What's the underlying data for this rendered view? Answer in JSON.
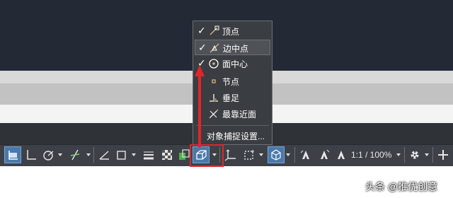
{
  "snap_menu": {
    "items": [
      {
        "label": "顶点",
        "checked": true,
        "icon": "endpoint-snap-icon"
      },
      {
        "label": "边中点",
        "checked": true,
        "icon": "midpoint-snap-icon",
        "highlighted": true
      },
      {
        "label": "面中心",
        "checked": true,
        "icon": "face-center-snap-icon"
      },
      {
        "label": "节点",
        "checked": false,
        "icon": "node-snap-icon"
      },
      {
        "label": "垂足",
        "checked": false,
        "icon": "perpendicular-snap-icon"
      },
      {
        "label": "最靠近面",
        "checked": false,
        "icon": "nearest-face-snap-icon"
      }
    ],
    "check_mark": "✓",
    "settings_label": "对象捕捉设置..."
  },
  "statusbar": {
    "annotation_scale": "1:1 / 100%",
    "icons": [
      "dynamic-ucs-icon",
      "ortho-icon",
      "polar-tracking-icon",
      "isodraft-icon",
      "object-snap-tracking-icon",
      "object-snap-icon",
      "lineweight-icon",
      "transparency-icon",
      "selection-cycling-icon",
      "3d-object-snap-icon",
      "gizmo-icon",
      "selection-filter-icon",
      "ucs-3d-icon",
      "annotation-visibility-icon",
      "auto-scale-icon",
      "annotation-scale-icon",
      "workspace-gear-icon",
      "customize-plus-icon"
    ],
    "active_color": "#4a78a8"
  },
  "callout": {
    "color": "#e0262b"
  },
  "watermark": {
    "text": "头条 @推优创意"
  }
}
